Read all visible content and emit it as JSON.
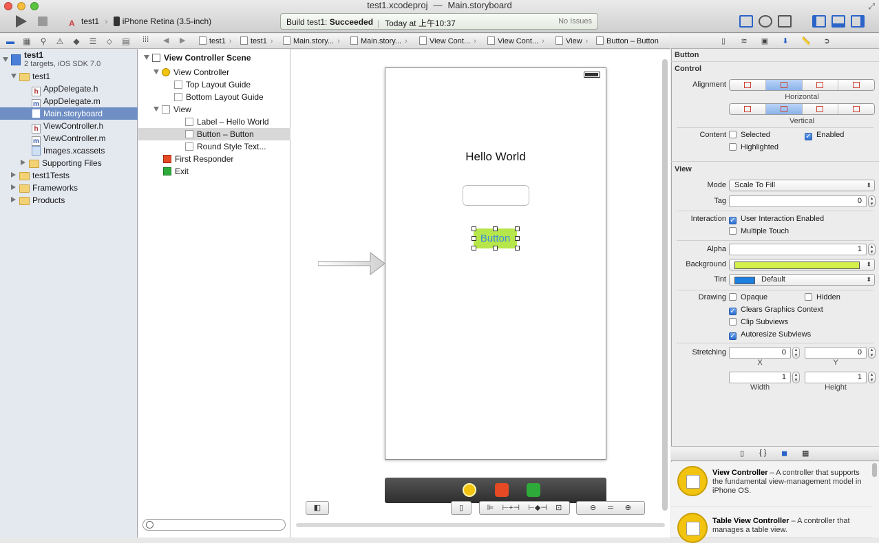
{
  "window": {
    "project_file": "test1.xcodeproj",
    "separator": "—",
    "open_file": "Main.storyboard"
  },
  "toolbar": {
    "scheme": "test1",
    "destination": "iPhone Retina (3.5-inch)",
    "activity_status_prefix": "Build test1: ",
    "activity_status_bold": "Succeeded",
    "activity_time": "Today at 上午10:37",
    "activity_issues": "No Issues"
  },
  "navigator": {
    "project_name": "test1",
    "project_subtitle": "2 targets, iOS SDK 7.0",
    "items": [
      {
        "label": "test1",
        "kind": "folder",
        "level": 1,
        "expanded": true
      },
      {
        "label": "AppDelegate.h",
        "kind": "h",
        "level": 2
      },
      {
        "label": "AppDelegate.m",
        "kind": "m",
        "level": 2
      },
      {
        "label": "Main.storyboard",
        "kind": "storyboard",
        "level": 2,
        "selected": true
      },
      {
        "label": "ViewController.h",
        "kind": "h",
        "level": 2
      },
      {
        "label": "ViewController.m",
        "kind": "m",
        "level": 2
      },
      {
        "label": "Images.xcassets",
        "kind": "xcassets",
        "level": 2
      },
      {
        "label": "Supporting Files",
        "kind": "folder",
        "level": 2,
        "expanded": false
      },
      {
        "label": "test1Tests",
        "kind": "folder",
        "level": 1,
        "expanded": false
      },
      {
        "label": "Frameworks",
        "kind": "folder",
        "level": 1,
        "expanded": false
      },
      {
        "label": "Products",
        "kind": "folder",
        "level": 1,
        "expanded": false
      }
    ]
  },
  "jumpbar": {
    "crumbs": [
      "test1",
      "test1",
      "Main.story...",
      "Main.story...",
      "View Cont...",
      "View Cont...",
      "View",
      "Button – Button"
    ]
  },
  "outline": {
    "scene": "View Controller Scene",
    "items": [
      {
        "label": "View Controller",
        "icon": "view-controller"
      },
      {
        "label": "Top Layout Guide",
        "icon": "guide"
      },
      {
        "label": "Bottom Layout Guide",
        "icon": "guide"
      },
      {
        "label": "View",
        "icon": "view"
      },
      {
        "label": "Label – Hello World",
        "icon": "view"
      },
      {
        "label": "Button – Button",
        "icon": "view",
        "selected": true
      },
      {
        "label": "Round Style Text...",
        "icon": "view"
      },
      {
        "label": "First Responder",
        "icon": "first-responder"
      },
      {
        "label": "Exit",
        "icon": "exit"
      }
    ]
  },
  "canvas": {
    "label_text": "Hello World",
    "button_text": "Button",
    "button_color": "#b6e64a",
    "button_text_color": "#3b8fd8"
  },
  "inspector": {
    "object": "Button",
    "control": {
      "title": "Control",
      "alignment_label": "Alignment",
      "horizontal_label": "Horizontal",
      "vertical_label": "Vertical",
      "horizontal_selected_index": 1,
      "vertical_selected_index": 1,
      "content_label": "Content",
      "selected_label": "Selected",
      "selected_checked": false,
      "enabled_label": "Enabled",
      "enabled_checked": true,
      "highlighted_label": "Highlighted",
      "highlighted_checked": false
    },
    "view": {
      "title": "View",
      "mode_label": "Mode",
      "mode_value": "Scale To Fill",
      "tag_label": "Tag",
      "tag_value": "0",
      "interaction_label": "Interaction",
      "user_interaction_label": "User Interaction Enabled",
      "user_interaction_checked": true,
      "multiple_touch_label": "Multiple Touch",
      "multiple_touch_checked": false,
      "alpha_label": "Alpha",
      "alpha_value": "1",
      "background_label": "Background",
      "background_color": "#d4f04a",
      "tint_label": "Tint",
      "tint_color": "#1f7fe0",
      "tint_value": "Default",
      "drawing_label": "Drawing",
      "opaque_label": "Opaque",
      "opaque_checked": false,
      "hidden_label": "Hidden",
      "hidden_checked": false,
      "clears_label": "Clears Graphics Context",
      "clears_checked": true,
      "clip_label": "Clip Subviews",
      "clip_checked": false,
      "autoresize_label": "Autoresize Subviews",
      "autoresize_checked": true,
      "stretching_label": "Stretching",
      "stretch_x": "0",
      "stretch_y": "0",
      "stretch_w": "1",
      "stretch_h": "1",
      "x_label": "X",
      "y_label": "Y",
      "width_label": "Width",
      "height_label": "Height"
    }
  },
  "library": {
    "items": [
      {
        "title": "View Controller",
        "desc": " – A controller that supports the fundamental view-management model in iPhone OS."
      },
      {
        "title": "Table View Controller",
        "desc": " – A controller that manages a table view."
      }
    ]
  }
}
